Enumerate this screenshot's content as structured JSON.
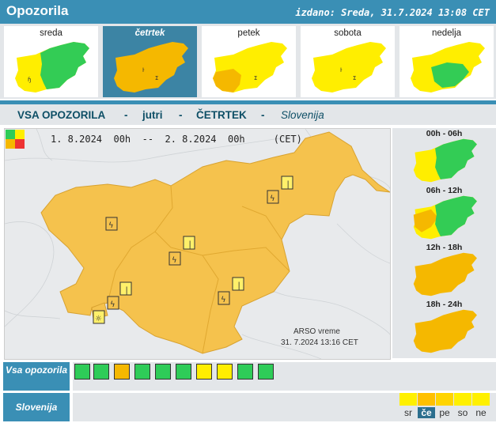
{
  "header": {
    "title": "Opozorila",
    "issued": "izdano: Sreda, 31.7.2024 13:08 CET"
  },
  "days": [
    {
      "label": "sreda",
      "selected": false
    },
    {
      "label": "četrtek",
      "selected": true
    },
    {
      "label": "petek",
      "selected": false
    },
    {
      "label": "sobota",
      "selected": false
    },
    {
      "label": "nedelja",
      "selected": false
    }
  ],
  "subtitle": {
    "all": "VSA OPOZORILA",
    "dash1": "-",
    "when": "jutri",
    "dash2": "-",
    "day": "ČETRTEK",
    "dash3": "-",
    "region": "Slovenija"
  },
  "main_map": {
    "range": "1. 8.2024  00h  --  2. 8.2024  00h     (CET)",
    "credit_line1": "ARSO vreme",
    "credit_line2": "31. 7.2024  13:16 CET"
  },
  "slots": [
    {
      "label": "00h - 06h"
    },
    {
      "label": "06h - 12h"
    },
    {
      "label": "12h - 18h"
    },
    {
      "label": "18h - 24h"
    }
  ],
  "rows": {
    "all_label": "Vsa opozorila",
    "region_label": "Slovenija"
  },
  "warning_types": [
    {
      "icon": "wind-icon",
      "level": "green"
    },
    {
      "icon": "rain-icon",
      "level": "green"
    },
    {
      "icon": "thunderstorm-icon",
      "level": "orange"
    },
    {
      "icon": "snow-icon",
      "level": "green"
    },
    {
      "icon": "fog-icon",
      "level": "green"
    },
    {
      "icon": "low-temperature-icon",
      "level": "green"
    },
    {
      "icon": "high-temperature-icon",
      "level": "yellow"
    },
    {
      "icon": "fire-risk-icon",
      "level": "yellow"
    },
    {
      "icon": "coastal-icon",
      "level": "green"
    },
    {
      "icon": "avalanche-icon",
      "level": "green"
    }
  ],
  "week_strip": [
    {
      "abbr": "sr",
      "color": "#fff000",
      "selected": false
    },
    {
      "abbr": "če",
      "color": "#ffc000",
      "selected": true
    },
    {
      "abbr": "pe",
      "color": "#ffd400",
      "selected": false
    },
    {
      "abbr": "so",
      "color": "#fff000",
      "selected": false
    },
    {
      "abbr": "ne",
      "color": "#fff000",
      "selected": false
    }
  ],
  "colors": {
    "header": "#3a8fb5",
    "green": "#2ecc58",
    "yellow": "#ffee00",
    "orange": "#f5b800",
    "red": "#ee3333"
  }
}
